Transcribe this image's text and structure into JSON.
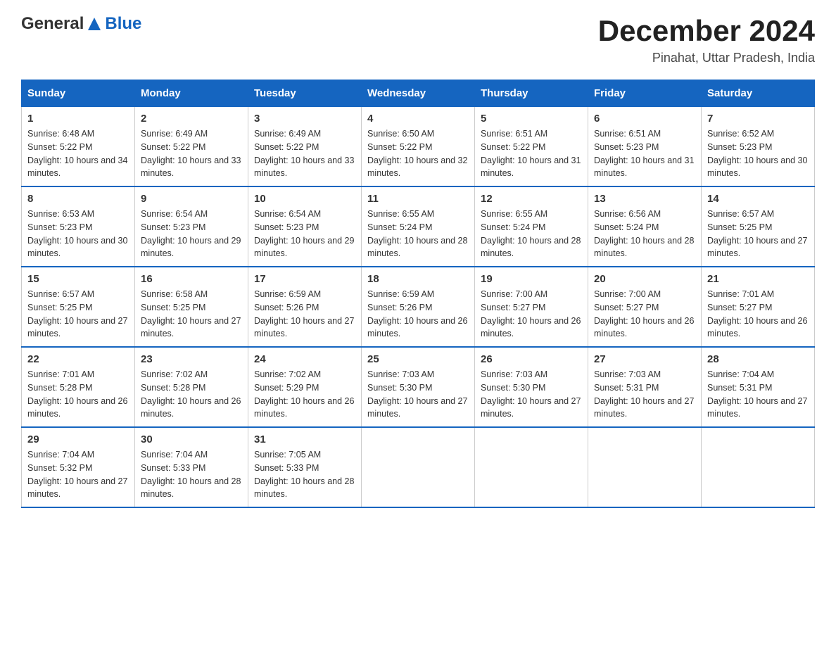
{
  "header": {
    "logo_general": "General",
    "logo_blue": "Blue",
    "title": "December 2024",
    "subtitle": "Pinahat, Uttar Pradesh, India"
  },
  "days_of_week": [
    "Sunday",
    "Monday",
    "Tuesday",
    "Wednesday",
    "Thursday",
    "Friday",
    "Saturday"
  ],
  "weeks": [
    [
      {
        "day": "1",
        "sunrise": "6:48 AM",
        "sunset": "5:22 PM",
        "daylight": "10 hours and 34 minutes."
      },
      {
        "day": "2",
        "sunrise": "6:49 AM",
        "sunset": "5:22 PM",
        "daylight": "10 hours and 33 minutes."
      },
      {
        "day": "3",
        "sunrise": "6:49 AM",
        "sunset": "5:22 PM",
        "daylight": "10 hours and 33 minutes."
      },
      {
        "day": "4",
        "sunrise": "6:50 AM",
        "sunset": "5:22 PM",
        "daylight": "10 hours and 32 minutes."
      },
      {
        "day": "5",
        "sunrise": "6:51 AM",
        "sunset": "5:22 PM",
        "daylight": "10 hours and 31 minutes."
      },
      {
        "day": "6",
        "sunrise": "6:51 AM",
        "sunset": "5:23 PM",
        "daylight": "10 hours and 31 minutes."
      },
      {
        "day": "7",
        "sunrise": "6:52 AM",
        "sunset": "5:23 PM",
        "daylight": "10 hours and 30 minutes."
      }
    ],
    [
      {
        "day": "8",
        "sunrise": "6:53 AM",
        "sunset": "5:23 PM",
        "daylight": "10 hours and 30 minutes."
      },
      {
        "day": "9",
        "sunrise": "6:54 AM",
        "sunset": "5:23 PM",
        "daylight": "10 hours and 29 minutes."
      },
      {
        "day": "10",
        "sunrise": "6:54 AM",
        "sunset": "5:23 PM",
        "daylight": "10 hours and 29 minutes."
      },
      {
        "day": "11",
        "sunrise": "6:55 AM",
        "sunset": "5:24 PM",
        "daylight": "10 hours and 28 minutes."
      },
      {
        "day": "12",
        "sunrise": "6:55 AM",
        "sunset": "5:24 PM",
        "daylight": "10 hours and 28 minutes."
      },
      {
        "day": "13",
        "sunrise": "6:56 AM",
        "sunset": "5:24 PM",
        "daylight": "10 hours and 28 minutes."
      },
      {
        "day": "14",
        "sunrise": "6:57 AM",
        "sunset": "5:25 PM",
        "daylight": "10 hours and 27 minutes."
      }
    ],
    [
      {
        "day": "15",
        "sunrise": "6:57 AM",
        "sunset": "5:25 PM",
        "daylight": "10 hours and 27 minutes."
      },
      {
        "day": "16",
        "sunrise": "6:58 AM",
        "sunset": "5:25 PM",
        "daylight": "10 hours and 27 minutes."
      },
      {
        "day": "17",
        "sunrise": "6:59 AM",
        "sunset": "5:26 PM",
        "daylight": "10 hours and 27 minutes."
      },
      {
        "day": "18",
        "sunrise": "6:59 AM",
        "sunset": "5:26 PM",
        "daylight": "10 hours and 26 minutes."
      },
      {
        "day": "19",
        "sunrise": "7:00 AM",
        "sunset": "5:27 PM",
        "daylight": "10 hours and 26 minutes."
      },
      {
        "day": "20",
        "sunrise": "7:00 AM",
        "sunset": "5:27 PM",
        "daylight": "10 hours and 26 minutes."
      },
      {
        "day": "21",
        "sunrise": "7:01 AM",
        "sunset": "5:27 PM",
        "daylight": "10 hours and 26 minutes."
      }
    ],
    [
      {
        "day": "22",
        "sunrise": "7:01 AM",
        "sunset": "5:28 PM",
        "daylight": "10 hours and 26 minutes."
      },
      {
        "day": "23",
        "sunrise": "7:02 AM",
        "sunset": "5:28 PM",
        "daylight": "10 hours and 26 minutes."
      },
      {
        "day": "24",
        "sunrise": "7:02 AM",
        "sunset": "5:29 PM",
        "daylight": "10 hours and 26 minutes."
      },
      {
        "day": "25",
        "sunrise": "7:03 AM",
        "sunset": "5:30 PM",
        "daylight": "10 hours and 27 minutes."
      },
      {
        "day": "26",
        "sunrise": "7:03 AM",
        "sunset": "5:30 PM",
        "daylight": "10 hours and 27 minutes."
      },
      {
        "day": "27",
        "sunrise": "7:03 AM",
        "sunset": "5:31 PM",
        "daylight": "10 hours and 27 minutes."
      },
      {
        "day": "28",
        "sunrise": "7:04 AM",
        "sunset": "5:31 PM",
        "daylight": "10 hours and 27 minutes."
      }
    ],
    [
      {
        "day": "29",
        "sunrise": "7:04 AM",
        "sunset": "5:32 PM",
        "daylight": "10 hours and 27 minutes."
      },
      {
        "day": "30",
        "sunrise": "7:04 AM",
        "sunset": "5:33 PM",
        "daylight": "10 hours and 28 minutes."
      },
      {
        "day": "31",
        "sunrise": "7:05 AM",
        "sunset": "5:33 PM",
        "daylight": "10 hours and 28 minutes."
      },
      null,
      null,
      null,
      null
    ]
  ],
  "labels": {
    "sunrise_prefix": "Sunrise: ",
    "sunset_prefix": "Sunset: ",
    "daylight_prefix": "Daylight: "
  }
}
